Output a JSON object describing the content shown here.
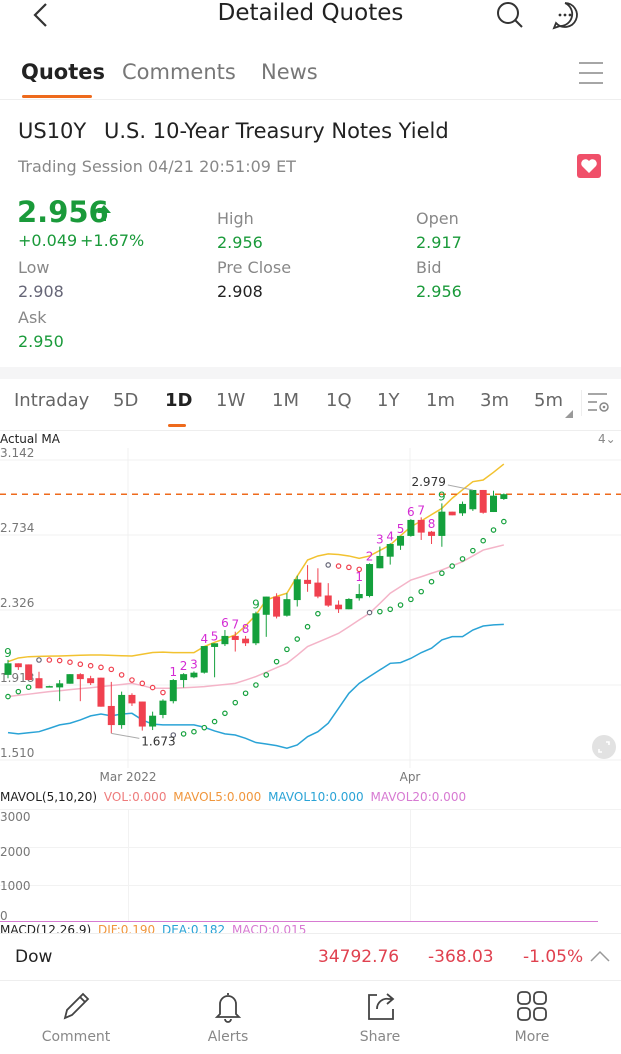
{
  "header": {
    "title": "Detailed Quotes",
    "icons": [
      "back-arrow-icon",
      "search-icon",
      "chat-icon"
    ]
  },
  "tabs": [
    {
      "label": "Quotes",
      "active": true
    },
    {
      "label": "Comments"
    },
    {
      "label": "News"
    }
  ],
  "accent": "#ee6a1c",
  "security": {
    "symbol": "US10Y",
    "name": "U.S. 10-Year Treasury Notes Yield",
    "session": "Trading Session 04/21 20:51:09 ET",
    "favorite": true
  },
  "quote": {
    "price": "2.956",
    "change": "+0.049",
    "change_pct": "+1.67%",
    "fields": [
      {
        "label": "High",
        "value": "2.956",
        "color": "green"
      },
      {
        "label": "Open",
        "value": "2.917",
        "color": "green"
      },
      {
        "label": "Low",
        "value": "2.908",
        "color": "grey"
      },
      {
        "label": "Pre Close",
        "value": "2.908",
        "color": "black"
      },
      {
        "label": "Bid",
        "value": "2.956",
        "color": "green"
      },
      {
        "label": "Ask",
        "value": "2.950",
        "color": "green"
      }
    ]
  },
  "periods": [
    "Intraday",
    "5D",
    "1D",
    "1W",
    "1M",
    "1Q",
    "1Y",
    "1m",
    "3m",
    "5m"
  ],
  "active_period": "1D",
  "chart": {
    "indicator_label": "Actual  MA",
    "count_label": "4",
    "max_label": "2.979",
    "min_label": "1.673",
    "x_labels": [
      "Mar 2022",
      "Apr"
    ],
    "vol": {
      "title": "MAVOL(5,10,20)",
      "vol": "VOL:0.000",
      "mavol5": "MAVOL5:0.000",
      "mavol10": "MAVOL10:0.000",
      "mavol20": "MAVOL20:0.000",
      "y_labels": [
        "3000",
        "2000",
        "1000",
        "0"
      ]
    },
    "macd": {
      "title": "MACD(12,26,9)",
      "dif": "DIF:0.190",
      "dea": "DEA:0.182",
      "macd": "MACD:0.015"
    }
  },
  "chart_data": {
    "type": "candlestick",
    "y_ticks": [
      "3.142",
      "2.734",
      "2.326",
      "1.918",
      "1.510"
    ],
    "ylim": [
      1.51,
      3.142
    ],
    "current_price": 2.956,
    "colors": {
      "up": "#14a03c",
      "down": "#f0414f",
      "upper": "#f2c230",
      "middle": "#f4b4c8",
      "lower": "#2aa3d6",
      "price_line": "#ee6a1c"
    },
    "ohlc": [
      [
        1.973,
        2.055,
        1.955,
        2.036
      ],
      [
        2.036,
        2.036,
        2.0,
        2.015
      ],
      [
        2.03,
        2.03,
        1.945,
        1.945
      ],
      [
        1.955,
        1.99,
        1.9,
        1.9
      ],
      [
        1.908,
        1.914,
        1.906,
        1.912
      ],
      [
        1.905,
        1.945,
        1.83,
        1.927
      ],
      [
        1.925,
        1.977,
        1.925,
        1.977
      ],
      [
        1.977,
        1.982,
        1.83,
        1.95
      ],
      [
        1.955,
        1.968,
        1.918,
        1.928
      ],
      [
        1.958,
        1.958,
        1.8,
        1.8
      ],
      [
        1.804,
        1.935,
        1.655,
        1.7
      ],
      [
        1.7,
        1.882,
        1.68,
        1.864
      ],
      [
        1.864,
        1.873,
        1.804,
        1.818
      ],
      [
        1.828,
        1.828,
        1.67,
        1.692
      ],
      [
        1.692,
        1.773,
        1.673,
        1.751
      ],
      [
        1.755,
        1.84,
        1.737,
        1.833
      ],
      [
        1.83,
        1.95,
        1.818,
        1.945
      ],
      [
        1.945,
        1.982,
        1.904,
        1.977
      ],
      [
        1.96,
        1.992,
        1.955,
        1.985
      ],
      [
        1.985,
        2.13,
        1.98,
        2.13
      ],
      [
        2.125,
        2.145,
        1.96,
        2.145
      ],
      [
        2.14,
        2.217,
        2.13,
        2.185
      ],
      [
        2.185,
        2.208,
        2.1,
        2.163
      ],
      [
        2.17,
        2.185,
        2.13,
        2.145
      ],
      [
        2.145,
        2.317,
        2.135,
        2.308
      ],
      [
        2.3,
        2.399,
        2.18,
        2.399
      ],
      [
        2.399,
        2.417,
        2.28,
        2.29
      ],
      [
        2.295,
        2.417,
        2.29,
        2.385
      ],
      [
        2.38,
        2.513,
        2.345,
        2.493
      ],
      [
        2.49,
        2.57,
        2.425,
        2.468
      ],
      [
        2.475,
        2.553,
        2.39,
        2.399
      ],
      [
        2.405,
        2.472,
        2.343,
        2.35
      ],
      [
        2.355,
        2.378,
        2.31,
        2.33
      ],
      [
        2.33,
        2.39,
        2.33,
        2.386
      ],
      [
        2.39,
        2.467,
        2.377,
        2.413
      ],
      [
        2.402,
        2.58,
        2.395,
        2.576
      ],
      [
        2.553,
        2.671,
        2.553,
        2.62
      ],
      [
        2.616,
        2.689,
        2.573,
        2.685
      ],
      [
        2.676,
        2.729,
        2.653,
        2.729
      ],
      [
        2.729,
        2.82,
        2.725,
        2.816
      ],
      [
        2.816,
        2.83,
        2.707,
        2.747
      ],
      [
        2.752,
        2.756,
        2.685,
        2.729
      ],
      [
        2.729,
        2.906,
        2.67,
        2.861
      ],
      [
        2.861,
        2.861,
        2.841,
        2.841
      ],
      [
        2.852,
        2.916,
        2.838,
        2.903
      ],
      [
        2.874,
        2.979,
        2.865,
        2.979
      ],
      [
        2.979,
        2.979,
        2.85,
        2.855
      ],
      [
        2.859,
        2.975,
        2.859,
        2.948
      ],
      [
        2.93,
        2.96,
        2.925,
        2.956
      ]
    ],
    "upper": [
      2.045,
      2.065,
      2.072,
      2.074,
      2.075,
      2.076,
      2.078,
      2.08,
      2.081,
      2.081,
      2.079,
      2.077,
      2.076,
      2.085,
      2.095,
      2.097,
      2.094,
      2.094,
      2.094,
      2.127,
      2.15,
      2.17,
      2.19,
      2.24,
      2.299,
      2.381,
      2.4,
      2.417,
      2.51,
      2.598,
      2.62,
      2.631,
      2.628,
      2.62,
      2.607,
      2.62,
      2.65,
      2.68,
      2.73,
      2.779,
      2.81,
      2.845,
      2.879,
      2.934,
      2.98,
      3.024,
      3.033,
      3.075,
      3.12
    ],
    "middle": [
      1.855,
      1.862,
      1.868,
      1.875,
      1.882,
      1.887,
      1.893,
      1.898,
      1.903,
      1.909,
      1.915,
      1.921,
      1.927,
      1.915,
      1.9,
      1.9,
      1.9,
      1.903,
      1.906,
      1.909,
      1.915,
      1.921,
      1.927,
      1.945,
      1.964,
      1.988,
      2.012,
      2.036,
      2.08,
      2.127,
      2.151,
      2.175,
      2.199,
      2.235,
      2.272,
      2.308,
      2.362,
      2.417,
      2.453,
      2.489,
      2.507,
      2.526,
      2.544,
      2.566,
      2.589,
      2.62,
      2.652,
      2.666,
      2.68
    ],
    "lower": [
      1.659,
      1.652,
      1.658,
      1.664,
      1.682,
      1.701,
      1.71,
      1.728,
      1.75,
      1.76,
      1.75,
      1.76,
      1.764,
      1.728,
      1.705,
      1.701,
      1.701,
      1.701,
      1.701,
      1.688,
      1.668,
      1.652,
      1.646,
      1.628,
      1.605,
      1.597,
      1.588,
      1.574,
      1.592,
      1.637,
      1.664,
      1.71,
      1.791,
      1.873,
      1.927,
      1.964,
      2.0,
      2.036,
      2.04,
      2.063,
      2.094,
      2.118,
      2.163,
      2.181,
      2.181,
      2.217,
      2.239,
      2.245,
      2.248
    ],
    "sar": [
      [
        1.855,
        "g"
      ],
      [
        1.882,
        "g"
      ],
      [
        1.906,
        "g"
      ],
      [
        2.054,
        "n"
      ],
      [
        2.054,
        "r"
      ],
      [
        2.051,
        "r"
      ],
      [
        2.042,
        "r"
      ],
      [
        2.031,
        "r"
      ],
      [
        2.023,
        "r"
      ],
      [
        2.014,
        "r"
      ],
      [
        2.003,
        "r"
      ],
      [
        1.973,
        "r"
      ],
      [
        1.945,
        "r"
      ],
      [
        1.927,
        "r"
      ],
      [
        1.904,
        "r"
      ],
      [
        1.877,
        "r"
      ],
      [
        1.646,
        "n"
      ],
      [
        1.652,
        "g"
      ],
      [
        1.664,
        "g"
      ],
      [
        1.686,
        "g"
      ],
      [
        1.719,
        "g"
      ],
      [
        1.764,
        "g"
      ],
      [
        1.822,
        "g"
      ],
      [
        1.873,
        "g"
      ],
      [
        1.918,
        "g"
      ],
      [
        1.973,
        "g"
      ],
      [
        2.045,
        "g"
      ],
      [
        2.112,
        "g"
      ],
      [
        2.168,
        "g"
      ],
      [
        2.235,
        "g"
      ],
      [
        2.306,
        "g"
      ],
      [
        2.571,
        "n"
      ],
      [
        2.565,
        "r"
      ],
      [
        2.558,
        "r"
      ],
      [
        2.547,
        "r"
      ],
      [
        2.312,
        "n"
      ],
      [
        2.317,
        "g"
      ],
      [
        2.33,
        "g"
      ],
      [
        2.353,
        "g"
      ],
      [
        2.384,
        "g"
      ],
      [
        2.426,
        "g"
      ],
      [
        2.48,
        "g"
      ],
      [
        2.526,
        "g"
      ],
      [
        2.565,
        "g"
      ],
      [
        2.604,
        "g"
      ],
      [
        2.649,
        "g"
      ],
      [
        2.703,
        "g"
      ],
      [
        2.761,
        "g"
      ],
      [
        2.807,
        "g"
      ]
    ],
    "td_labels": [
      [
        0,
        "9"
      ],
      [
        16,
        "1"
      ],
      [
        17,
        "2"
      ],
      [
        18,
        "3"
      ],
      [
        19,
        "4"
      ],
      [
        20,
        "5"
      ],
      [
        21,
        "6"
      ],
      [
        22,
        "7"
      ],
      [
        23,
        "8"
      ],
      [
        24,
        "9"
      ],
      [
        34,
        "1"
      ],
      [
        35,
        "2"
      ],
      [
        36,
        "3"
      ],
      [
        37,
        "4"
      ],
      [
        38,
        "5"
      ],
      [
        39,
        "6"
      ],
      [
        40,
        "7"
      ],
      [
        41,
        "8"
      ],
      [
        42,
        "9"
      ]
    ]
  },
  "ticker_bar": {
    "name": "Dow",
    "price": "34792.76",
    "change": "-368.03",
    "change_pct": "-1.05%"
  },
  "bottom_nav": [
    {
      "label": "Comment",
      "icon": "pencil-icon"
    },
    {
      "label": "Alerts",
      "icon": "bell-icon"
    },
    {
      "label": "Share",
      "icon": "share-icon"
    },
    {
      "label": "More",
      "icon": "grid-icon"
    }
  ]
}
